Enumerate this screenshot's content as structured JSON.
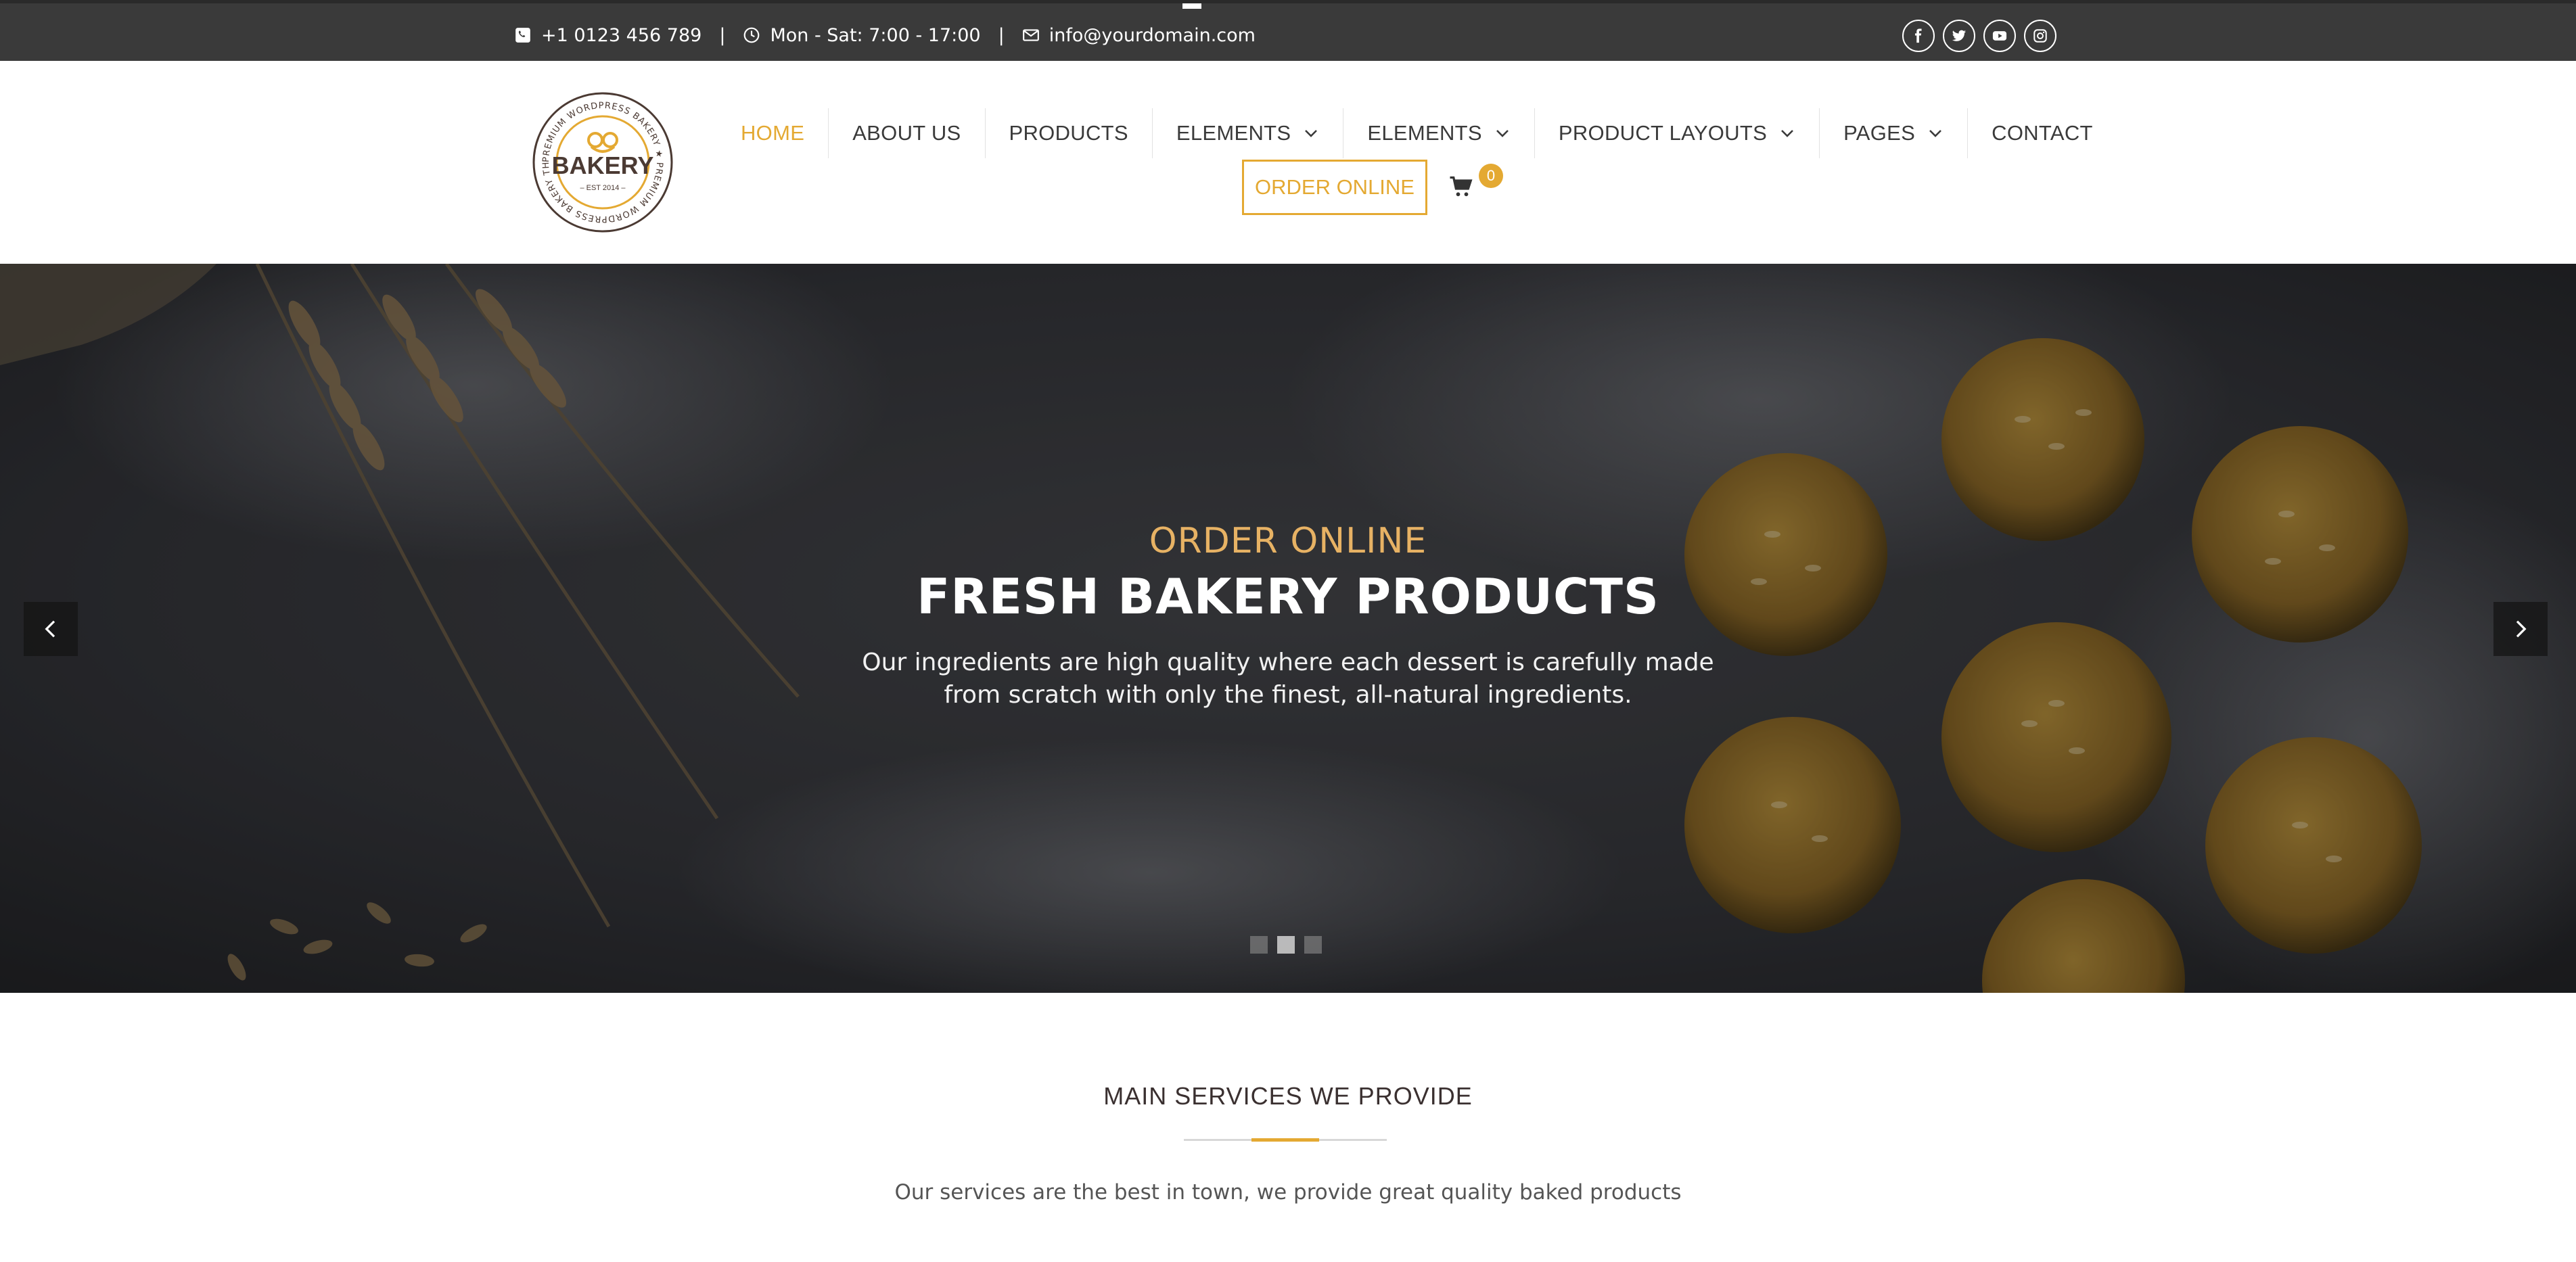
{
  "topbar": {
    "phone": "+1 0123 456 789",
    "hours": "Mon - Sat: 7:00 - 17:00",
    "email": "info@yourdomain.com",
    "separator": "|",
    "social": [
      "facebook-icon",
      "twitter-icon",
      "youtube-icon",
      "instagram-icon"
    ]
  },
  "logo": {
    "name": "BAKERY",
    "ring_text": "PREMIUM WORDPRESS BAKERY ★ PREMIUM WORDPRESS BAKERY THEME ★",
    "est": "– EST 2014 –"
  },
  "nav": {
    "items": [
      {
        "label": "HOME",
        "active": true
      },
      {
        "label": "ABOUT US"
      },
      {
        "label": "PRODUCTS"
      },
      {
        "label": "ELEMENTS",
        "dropdown": true
      },
      {
        "label": "ELEMENTS",
        "dropdown": true
      },
      {
        "label": "PRODUCT LAYOUTS",
        "dropdown": true
      },
      {
        "label": "PAGES",
        "dropdown": true
      },
      {
        "label": "CONTACT"
      }
    ],
    "order_button": "ORDER ONLINE",
    "cart_count": "0"
  },
  "hero": {
    "subtitle": "ORDER ONLINE",
    "title": "FRESH BAKERY PRODUCTS",
    "description": "Our ingredients are high quality where each dessert is carefully made from scratch with only the finest, all-natural ingredients.",
    "slides": 3,
    "active_slide": 2
  },
  "services": {
    "title": "MAIN SERVICES WE PROVIDE",
    "description": "Our services are the best in town, we provide great quality baked products"
  },
  "colors": {
    "accent": "#e4a932",
    "topbar_bg": "#3a3a3a",
    "hero_subtitle": "#e7b264"
  }
}
